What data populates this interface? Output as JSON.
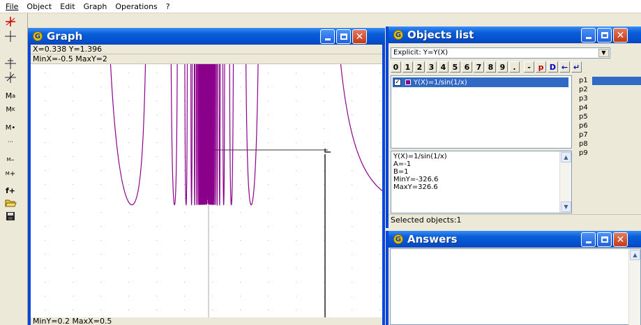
{
  "menu": {
    "items": [
      "File",
      "Object",
      "Edit",
      "Graph",
      "Operations",
      "?"
    ]
  },
  "toolbar": {
    "tools": [
      "add-point-tool",
      "crosshair-tool",
      "cross-plus-tool",
      "cross-tool",
      "ma-tool",
      "mk-tool",
      "m-dot-tool",
      "marks-tool",
      "m-minus-tool",
      "m-plus-tool",
      "f-plus-tool",
      "open-folder-icon",
      "save-disk-icon"
    ]
  },
  "graph_window": {
    "title": "Graph",
    "coords": "X=0.338  Y=1.396",
    "top_range": "MinX=-0.5  MaxY=2",
    "bottom_range": "MinY=0.2  MaxX=0.5",
    "curve_color": "#8b008b"
  },
  "objects_window": {
    "title": "Objects list",
    "type_select": "Explicit: Y=Y(X)",
    "keypad": [
      "0",
      "1",
      "2",
      "3",
      "4",
      "5",
      "6",
      "7",
      "8",
      "9",
      ".",
      "-",
      "p",
      "D",
      "←",
      "↵"
    ],
    "object_item": "Y(X)=1/sin(1/x)",
    "object_checked": true,
    "params": [
      "p1",
      "p2",
      "p3",
      "p4",
      "p5",
      "p6",
      "p7",
      "p8",
      "p9"
    ],
    "info": [
      "Y(X)=1/sin(1/x)",
      "A=-1",
      "B=1",
      "MinY=-326.6",
      "MaxY=326.6"
    ],
    "selected_status": "Selected objects:1"
  },
  "answers_window": {
    "title": "Answers"
  }
}
